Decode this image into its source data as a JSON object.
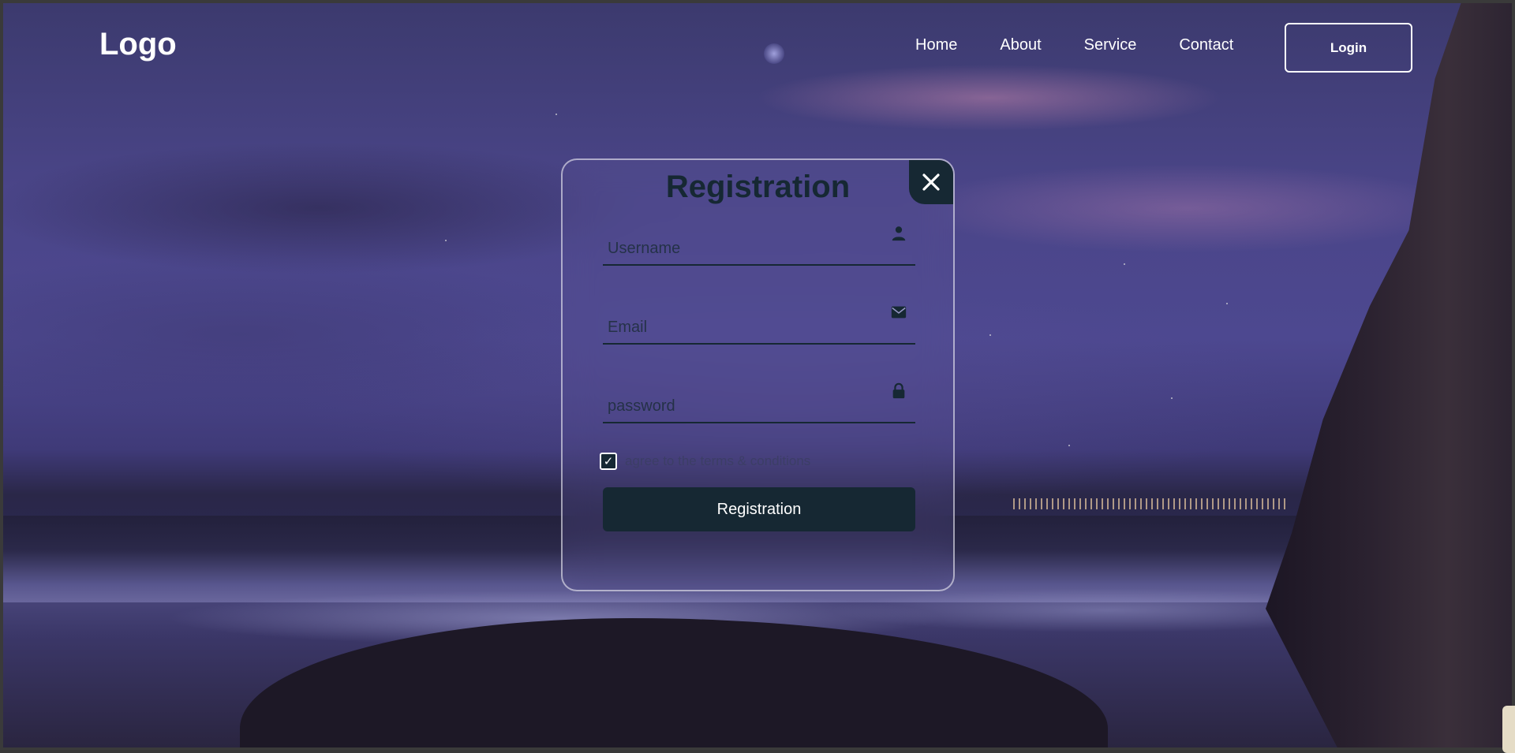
{
  "header": {
    "logo": "Logo",
    "nav": [
      "Home",
      "About",
      "Service",
      "Contact"
    ],
    "login_button": "Login"
  },
  "modal": {
    "title": "Registration",
    "close_icon": "close-icon",
    "fields": [
      {
        "placeholder": "Username",
        "value": "",
        "icon": "user-icon"
      },
      {
        "placeholder": "Email",
        "value": "",
        "icon": "mail-icon"
      },
      {
        "placeholder": "password",
        "value": "",
        "icon": "lock-icon"
      }
    ],
    "terms": {
      "label": "agree to the terms & conditions",
      "checked": true
    },
    "submit_label": "Registration"
  },
  "colors": {
    "accent": "#162833",
    "text_light": "#ffffff"
  }
}
